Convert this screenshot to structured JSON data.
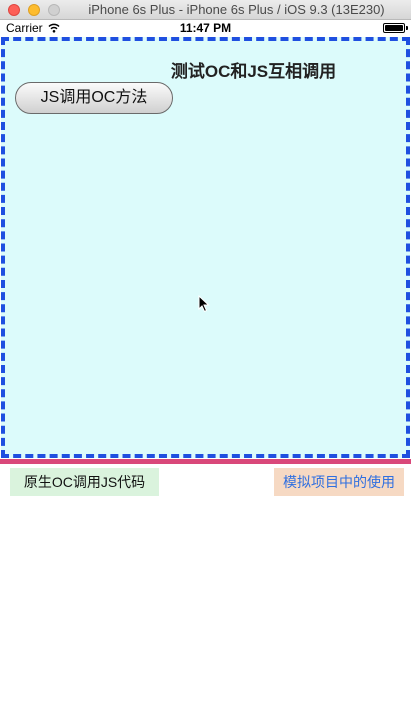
{
  "window": {
    "title": "iPhone 6s Plus - iPhone 6s Plus / iOS 9.3 (13E230)"
  },
  "status_bar": {
    "carrier": "Carrier",
    "time": "11:47 PM",
    "battery_level": 1.0
  },
  "web_view": {
    "title": "测试OC和JS互相调用",
    "button_label": "JS调用OC方法"
  },
  "native_buttons": {
    "left_label": "原生OC调用JS代码",
    "right_label": "模拟项目中的使用"
  },
  "colors": {
    "web_background": "#dcfbfb",
    "web_border": "#1f4fe0",
    "separator": "#d9487a",
    "left_button_bg": "#daf3dd",
    "right_button_bg": "#f6d9c3",
    "right_button_text": "#2f6fe0"
  }
}
